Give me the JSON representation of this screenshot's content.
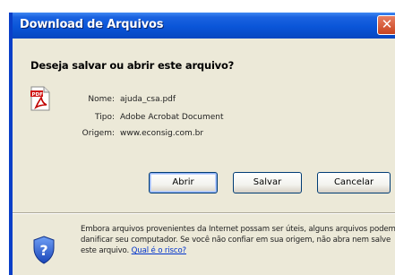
{
  "window": {
    "title": "Download de Arquivos",
    "close_symbol": "✕"
  },
  "dialog": {
    "question": "Deseja salvar ou abrir este arquivo?",
    "file_icon": "pdf-file-icon",
    "fields": [
      {
        "label": "Nome:",
        "value": "ajuda_csa.pdf"
      },
      {
        "label": "Tipo:",
        "value": "Adobe Acrobat Document"
      },
      {
        "label": "Origem:",
        "value": "www.econsig.com.br"
      }
    ],
    "buttons": {
      "open": "Abrir",
      "save": "Salvar",
      "cancel": "Cancelar"
    }
  },
  "warning": {
    "icon": "shield-question-icon",
    "text": "Embora arquivos provenientes da Internet possam ser úteis, alguns arquivos podem danificar seu computador. Se você não confiar em sua origem, não abra nem salve este arquivo.",
    "link": "Qual é o risco?"
  }
}
